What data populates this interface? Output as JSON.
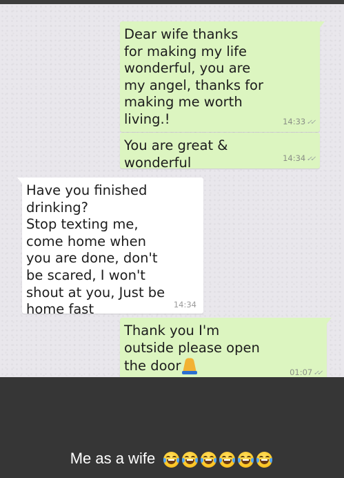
{
  "messages": [
    {
      "direction": "outgoing",
      "text": "Dear wife thanks\nfor making my life\nwonderful, you are\nmy angel, thanks for\nmaking me worth\nliving.!",
      "time": "14:33",
      "read_ticks": true
    },
    {
      "direction": "outgoing",
      "text": "You are great &\nwonderful",
      "time": "14:34",
      "read_ticks": true
    },
    {
      "direction": "incoming",
      "text": "Have you finished\ndrinking?\nStop texting me,\ncome home when\nyou are done, don't\nbe scared, I won't\nshout at you, Just be\nhome fast",
      "time": "14:34",
      "read_ticks": false
    },
    {
      "direction": "outgoing",
      "text": "Thank you I'm\noutside please open\nthe door",
      "trailing_emoji": "folded-hands-emoji",
      "time": "01:07",
      "read_ticks": true
    }
  ],
  "caption": {
    "text": "Me as a wife",
    "emojis": [
      "laughing-tears-emoji",
      "laughing-tears-emoji",
      "laughing-tears-emoji",
      "laughing-tears-emoji",
      "laughing-tears-emoji",
      "laughing-tears-emoji"
    ]
  },
  "colors": {
    "outgoing_bubble": "#dcf5c0",
    "incoming_bubble": "#ffffff",
    "chat_background": "#e9e7ec",
    "caption_background": "#363636",
    "caption_text": "#ffffff"
  }
}
